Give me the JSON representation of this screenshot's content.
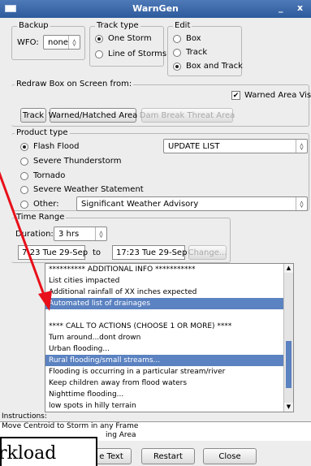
{
  "window": {
    "title": "WarnGen",
    "min": "_",
    "close": "x"
  },
  "backup": {
    "legend": "Backup",
    "wfo_label": "WFO:",
    "wfo_value": "none"
  },
  "track_type": {
    "legend": "Track type",
    "options": [
      "One Storm",
      "Line of Storms"
    ],
    "selected": 0
  },
  "edit": {
    "legend": "Edit",
    "options": [
      "Box",
      "Track",
      "Box and Track"
    ],
    "selected": 2
  },
  "redraw": {
    "legend": "Redraw Box on Screen from:",
    "warned_visible": "Warned Area Visible",
    "warned_checked": true,
    "buttons": [
      "Track",
      "Warned/Hatched Area",
      "Dam Break Threat Area"
    ]
  },
  "product_type": {
    "legend": "Product type",
    "options": [
      "Flash Flood",
      "Severe Thunderstorm",
      "Tornado",
      "Severe Weather Statement",
      "Other:"
    ],
    "selected": 0,
    "update_list": "UPDATE LIST",
    "other_value": "Significant Weather Advisory"
  },
  "time_range": {
    "legend": "Time Range",
    "duration_label": "Duration:",
    "duration_value": "3 hrs",
    "start": "7:23 Tue 29-Sep",
    "to": "to",
    "end": "17:23 Tue 29-Sep",
    "change": "Change..."
  },
  "bullets": {
    "items": [
      "********** ADDITIONAL INFO ***********",
      "List cities impacted",
      "Additional rainfall of XX inches expected",
      "Automated list of drainages",
      "",
      "**** CALL TO ACTIONS (CHOOSE 1 OR MORE) ****",
      "Turn around...dont drown",
      "Urban flooding...",
      "Rural flooding/small streams...",
      "Flooding is occurring in a particular stream/river",
      "Keep children away from flood waters",
      "Nighttime flooding...",
      "low spots in hilly terrain"
    ],
    "selected": [
      3,
      8
    ]
  },
  "instructions": {
    "label": "Instructions:",
    "lines": [
      "Move Centroid to Storm in any Frame",
      "ing Area"
    ]
  },
  "footer": {
    "create_text": "e Text",
    "restart": "Restart",
    "close": "Close"
  },
  "overlay_text": "rkload",
  "colors": {
    "selection": "#5b82c1",
    "annotation_arrow": "#e8101a"
  }
}
